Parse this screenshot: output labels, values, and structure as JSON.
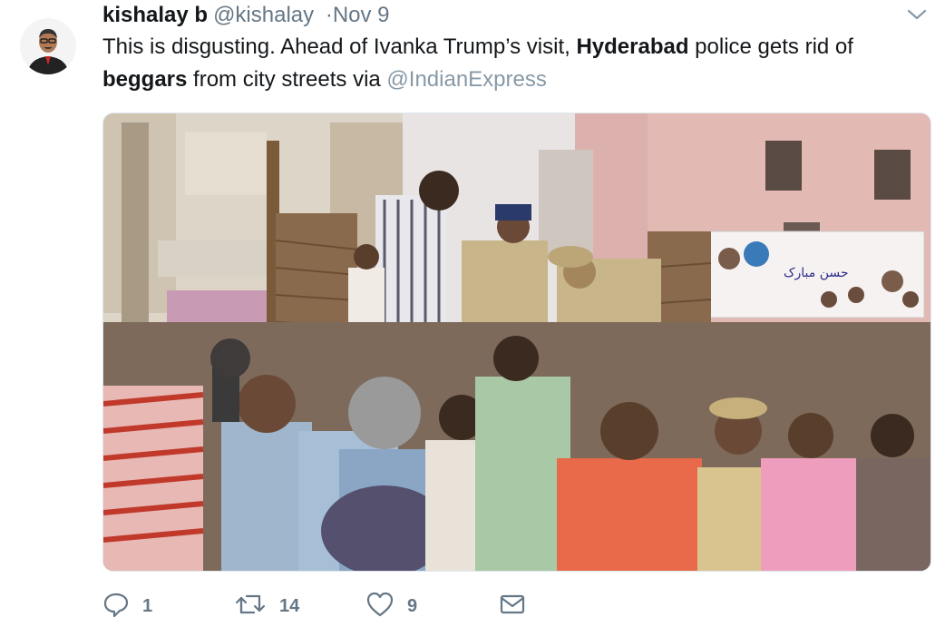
{
  "tweet": {
    "author_name": "kishalay b",
    "author_handle": "@kishalay",
    "dot": "·",
    "timestamp": "Nov 9",
    "text": {
      "part1": "This is disgusting. Ahead of Ivanka Trump’s visit, ",
      "bold1": "Hyderabad",
      "part2": " police gets rid of ",
      "bold2": "beggars",
      "part3": " from city streets via ",
      "mention": "@IndianExpress"
    },
    "actions": {
      "reply_count": "1",
      "retweet_count": "14",
      "like_count": "9"
    },
    "banner_text": "حسن مبارک"
  },
  "icons": {
    "caret": "chevron-down-icon",
    "reply": "reply-icon",
    "retweet": "retweet-icon",
    "like": "heart-icon",
    "dm": "envelope-icon"
  },
  "colors": {
    "secondary_text": "#657786",
    "link": "#8899a6",
    "primary_text": "#14171a"
  }
}
